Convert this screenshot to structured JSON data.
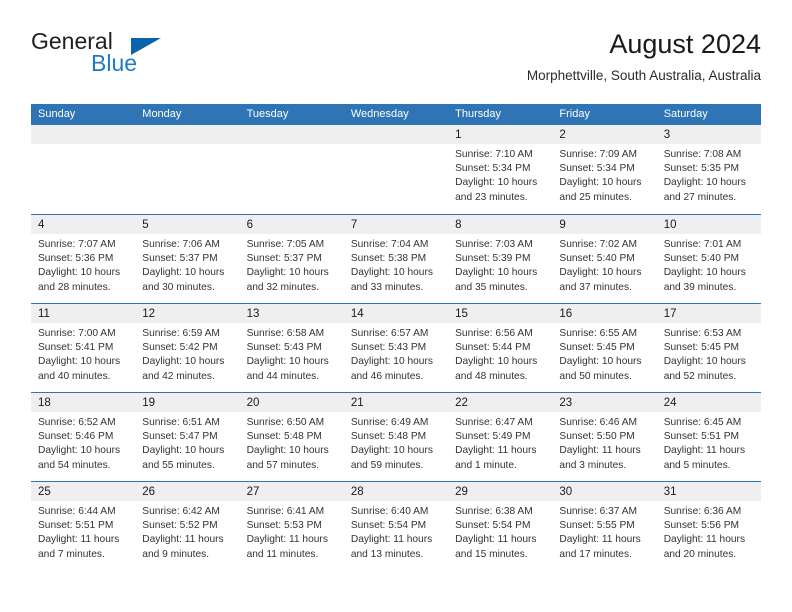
{
  "logo": {
    "word_one": "General",
    "word_two": "Blue",
    "triangle_color": "#0a63ab",
    "blue_text_color": "#1f7ac4"
  },
  "header": {
    "title": "August 2024",
    "subtitle": "Morphettville, South Australia, Australia"
  },
  "theme": {
    "header_blue": "#2F75B5",
    "day_band_gray": "#EFEFEF",
    "text_color": "#333333"
  },
  "weekday_headers": [
    "Sunday",
    "Monday",
    "Tuesday",
    "Wednesday",
    "Thursday",
    "Friday",
    "Saturday"
  ],
  "weeks": [
    [
      {
        "day": "",
        "lines": []
      },
      {
        "day": "",
        "lines": []
      },
      {
        "day": "",
        "lines": []
      },
      {
        "day": "",
        "lines": []
      },
      {
        "day": "1",
        "lines": [
          "Sunrise: 7:10 AM",
          "Sunset: 5:34 PM",
          "Daylight: 10 hours",
          "and 23 minutes."
        ]
      },
      {
        "day": "2",
        "lines": [
          "Sunrise: 7:09 AM",
          "Sunset: 5:34 PM",
          "Daylight: 10 hours",
          "and 25 minutes."
        ]
      },
      {
        "day": "3",
        "lines": [
          "Sunrise: 7:08 AM",
          "Sunset: 5:35 PM",
          "Daylight: 10 hours",
          "and 27 minutes."
        ]
      }
    ],
    [
      {
        "day": "4",
        "lines": [
          "Sunrise: 7:07 AM",
          "Sunset: 5:36 PM",
          "Daylight: 10 hours",
          "and 28 minutes."
        ]
      },
      {
        "day": "5",
        "lines": [
          "Sunrise: 7:06 AM",
          "Sunset: 5:37 PM",
          "Daylight: 10 hours",
          "and 30 minutes."
        ]
      },
      {
        "day": "6",
        "lines": [
          "Sunrise: 7:05 AM",
          "Sunset: 5:37 PM",
          "Daylight: 10 hours",
          "and 32 minutes."
        ]
      },
      {
        "day": "7",
        "lines": [
          "Sunrise: 7:04 AM",
          "Sunset: 5:38 PM",
          "Daylight: 10 hours",
          "and 33 minutes."
        ]
      },
      {
        "day": "8",
        "lines": [
          "Sunrise: 7:03 AM",
          "Sunset: 5:39 PM",
          "Daylight: 10 hours",
          "and 35 minutes."
        ]
      },
      {
        "day": "9",
        "lines": [
          "Sunrise: 7:02 AM",
          "Sunset: 5:40 PM",
          "Daylight: 10 hours",
          "and 37 minutes."
        ]
      },
      {
        "day": "10",
        "lines": [
          "Sunrise: 7:01 AM",
          "Sunset: 5:40 PM",
          "Daylight: 10 hours",
          "and 39 minutes."
        ]
      }
    ],
    [
      {
        "day": "11",
        "lines": [
          "Sunrise: 7:00 AM",
          "Sunset: 5:41 PM",
          "Daylight: 10 hours",
          "and 40 minutes."
        ]
      },
      {
        "day": "12",
        "lines": [
          "Sunrise: 6:59 AM",
          "Sunset: 5:42 PM",
          "Daylight: 10 hours",
          "and 42 minutes."
        ]
      },
      {
        "day": "13",
        "lines": [
          "Sunrise: 6:58 AM",
          "Sunset: 5:43 PM",
          "Daylight: 10 hours",
          "and 44 minutes."
        ]
      },
      {
        "day": "14",
        "lines": [
          "Sunrise: 6:57 AM",
          "Sunset: 5:43 PM",
          "Daylight: 10 hours",
          "and 46 minutes."
        ]
      },
      {
        "day": "15",
        "lines": [
          "Sunrise: 6:56 AM",
          "Sunset: 5:44 PM",
          "Daylight: 10 hours",
          "and 48 minutes."
        ]
      },
      {
        "day": "16",
        "lines": [
          "Sunrise: 6:55 AM",
          "Sunset: 5:45 PM",
          "Daylight: 10 hours",
          "and 50 minutes."
        ]
      },
      {
        "day": "17",
        "lines": [
          "Sunrise: 6:53 AM",
          "Sunset: 5:45 PM",
          "Daylight: 10 hours",
          "and 52 minutes."
        ]
      }
    ],
    [
      {
        "day": "18",
        "lines": [
          "Sunrise: 6:52 AM",
          "Sunset: 5:46 PM",
          "Daylight: 10 hours",
          "and 54 minutes."
        ]
      },
      {
        "day": "19",
        "lines": [
          "Sunrise: 6:51 AM",
          "Sunset: 5:47 PM",
          "Daylight: 10 hours",
          "and 55 minutes."
        ]
      },
      {
        "day": "20",
        "lines": [
          "Sunrise: 6:50 AM",
          "Sunset: 5:48 PM",
          "Daylight: 10 hours",
          "and 57 minutes."
        ]
      },
      {
        "day": "21",
        "lines": [
          "Sunrise: 6:49 AM",
          "Sunset: 5:48 PM",
          "Daylight: 10 hours",
          "and 59 minutes."
        ]
      },
      {
        "day": "22",
        "lines": [
          "Sunrise: 6:47 AM",
          "Sunset: 5:49 PM",
          "Daylight: 11 hours",
          "and 1 minute."
        ]
      },
      {
        "day": "23",
        "lines": [
          "Sunrise: 6:46 AM",
          "Sunset: 5:50 PM",
          "Daylight: 11 hours",
          "and 3 minutes."
        ]
      },
      {
        "day": "24",
        "lines": [
          "Sunrise: 6:45 AM",
          "Sunset: 5:51 PM",
          "Daylight: 11 hours",
          "and 5 minutes."
        ]
      }
    ],
    [
      {
        "day": "25",
        "lines": [
          "Sunrise: 6:44 AM",
          "Sunset: 5:51 PM",
          "Daylight: 11 hours",
          "and 7 minutes."
        ]
      },
      {
        "day": "26",
        "lines": [
          "Sunrise: 6:42 AM",
          "Sunset: 5:52 PM",
          "Daylight: 11 hours",
          "and 9 minutes."
        ]
      },
      {
        "day": "27",
        "lines": [
          "Sunrise: 6:41 AM",
          "Sunset: 5:53 PM",
          "Daylight: 11 hours",
          "and 11 minutes."
        ]
      },
      {
        "day": "28",
        "lines": [
          "Sunrise: 6:40 AM",
          "Sunset: 5:54 PM",
          "Daylight: 11 hours",
          "and 13 minutes."
        ]
      },
      {
        "day": "29",
        "lines": [
          "Sunrise: 6:38 AM",
          "Sunset: 5:54 PM",
          "Daylight: 11 hours",
          "and 15 minutes."
        ]
      },
      {
        "day": "30",
        "lines": [
          "Sunrise: 6:37 AM",
          "Sunset: 5:55 PM",
          "Daylight: 11 hours",
          "and 17 minutes."
        ]
      },
      {
        "day": "31",
        "lines": [
          "Sunrise: 6:36 AM",
          "Sunset: 5:56 PM",
          "Daylight: 11 hours",
          "and 20 minutes."
        ]
      }
    ]
  ]
}
